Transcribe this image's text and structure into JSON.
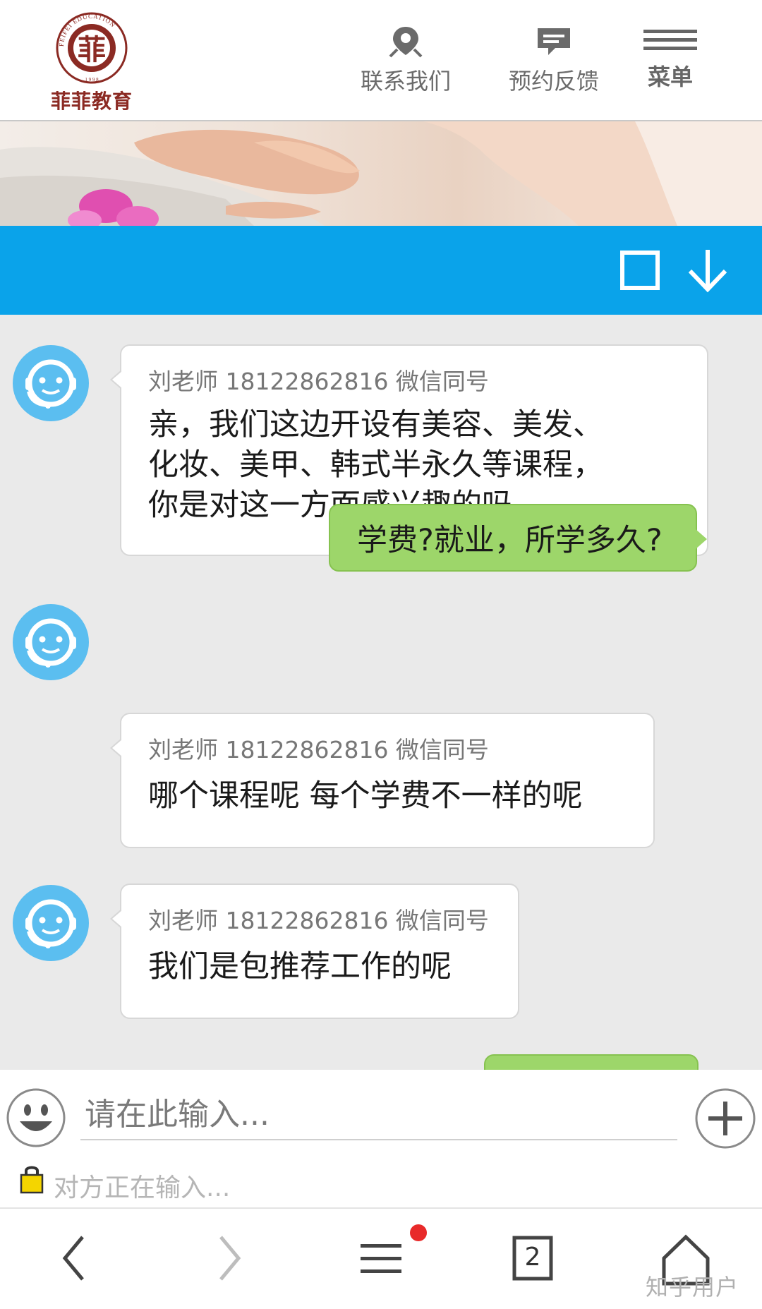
{
  "header": {
    "logo_name": "菲菲教育",
    "logo_ring_text": "FEIFEI EDUCATION",
    "logo_year": "1 9 9 8",
    "logo_char": "菲",
    "nav": {
      "contact_label": "联系我们",
      "feedback_label": "预约反馈",
      "menu_label": "菜单"
    }
  },
  "chat_bar": {
    "icons": [
      "square-icon",
      "arrow-down-icon"
    ]
  },
  "messages": [
    {
      "from": "agent",
      "sender": "刘老师 18122862816 微信同号",
      "lines": [
        "亲，我们这边开设有美容、美发、",
        "化妆、美甲、韩式半永久等课程，",
        "你是对这一方面感兴趣的吗"
      ]
    },
    {
      "from": "user",
      "text": "学费?就业，所学多久?"
    },
    {
      "from": "agent",
      "sender": "刘老师 18122862816 微信同号",
      "lines": [
        "哪个课程呢 每个学费不一样的呢"
      ]
    },
    {
      "from": "agent",
      "sender": "刘老师 18122862816 微信同号",
      "lines": [
        "我们是包推荐工作的呢"
      ]
    }
  ],
  "input": {
    "placeholder": "请在此输入...",
    "typing_status": "对方正在输入..."
  },
  "bottom_bar": {
    "tab_count": "2",
    "watermark": "知乎用户"
  },
  "colors": {
    "chat_bar": "#0aa3ea",
    "agent_avatar": "#5bbef0",
    "user_bubble": "#9dd66a",
    "logo_red": "#8b2a23",
    "notification_dot": "#e82a2a"
  }
}
